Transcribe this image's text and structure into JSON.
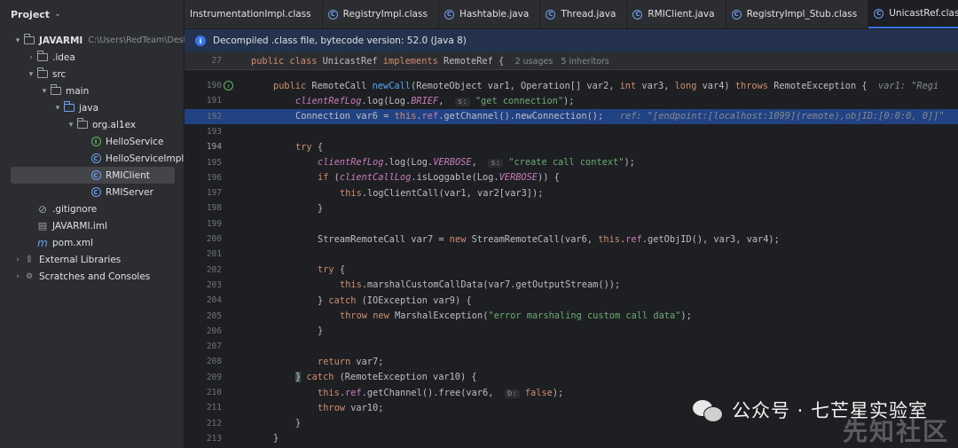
{
  "project": {
    "title": "Project",
    "tree": [
      {
        "label": "JAVARMI",
        "sub": "C:\\Users\\RedTeam\\Deskt",
        "indent": 0,
        "arrow": "▾",
        "icon": "folder",
        "bold": true
      },
      {
        "label": ".idea",
        "indent": 1,
        "arrow": "›",
        "icon": "folder"
      },
      {
        "label": "src",
        "indent": 1,
        "arrow": "▾",
        "icon": "folder"
      },
      {
        "label": "main",
        "indent": 2,
        "arrow": "▾",
        "icon": "folder"
      },
      {
        "label": "java",
        "indent": 3,
        "arrow": "▾",
        "icon": "folder-blue"
      },
      {
        "label": "org.al1ex",
        "indent": 4,
        "arrow": "▾",
        "icon": "folder"
      },
      {
        "label": "HelloService",
        "indent": 5,
        "arrow": "",
        "icon": "interface"
      },
      {
        "label": "HelloServiceImpl",
        "indent": 5,
        "arrow": "",
        "icon": "class"
      },
      {
        "label": "RMIClient",
        "indent": 5,
        "arrow": "",
        "icon": "class",
        "selected": true
      },
      {
        "label": "RMIServer",
        "indent": 5,
        "arrow": "",
        "icon": "class"
      },
      {
        "label": ".gitignore",
        "indent": 1,
        "arrow": "",
        "icon": "gitignore"
      },
      {
        "label": "JAVARMI.iml",
        "indent": 1,
        "arrow": "",
        "icon": "file"
      },
      {
        "label": "pom.xml",
        "indent": 1,
        "arrow": "",
        "icon": "maven"
      },
      {
        "label": "External Libraries",
        "indent": 0,
        "arrow": "›",
        "icon": "library"
      },
      {
        "label": "Scratches and Consoles",
        "indent": 0,
        "arrow": "›",
        "icon": "scratch"
      }
    ]
  },
  "tabs": [
    {
      "label": "InstrumentationImpl.class",
      "icon": "none"
    },
    {
      "label": "RegistryImpl.class",
      "icon": "class"
    },
    {
      "label": "Hashtable.java",
      "icon": "class"
    },
    {
      "label": "Thread.java",
      "icon": "class"
    },
    {
      "label": "RMIClient.java",
      "icon": "class"
    },
    {
      "label": "RegistryImpl_Stub.class",
      "icon": "class"
    },
    {
      "label": "UnicastRef.class",
      "icon": "class",
      "active": true
    }
  ],
  "banner": {
    "text": "Decompiled .class file, bytecode version: 52.0 (Java 8)"
  },
  "sticky": {
    "num": "27",
    "html": "<span class='k'>public class </span><span class='t'>UnicastRef </span><span class='k'>implements </span><span class='t'>RemoteRef {  </span><span class='dim' style='font-style:normal;font-family:DejaVu Sans,sans-serif;font-size:9.5px'>2 usages   5 inheritors</span>"
  },
  "lines": [
    {
      "num": "190",
      "mark": true,
      "indent": 1,
      "html": "<span class='k'>public </span><span class='t'>RemoteCall </span><span class='m'>newCall</span><span class='t'>(RemoteObject var1, Operation[] var2, </span><span class='k'>int </span><span class='t'>var3, </span><span class='k'>long </span><span class='t'>var4) </span><span class='k'>throws </span><span class='t'>RemoteException {  </span><span class='dim'>var1: \"Regi</span>"
    },
    {
      "num": "191",
      "indent": 2,
      "html": "<span class='fi'>clientRefLog</span><span class='t'>.log(Log.</span><span class='st'>BRIEF</span><span class='t'>,  </span><span class='hint'>s:</span><span class='s'> \"get connection\"</span><span class='t'>);</span>"
    },
    {
      "num": "192",
      "indent": 2,
      "hl": true,
      "html": "<span class='t'>Connection var6 = </span><span class='k'>this</span><span class='t'>.</span><span class='f'>ref</span><span class='t'>.getChannel().newConnection();   </span><span class='dim'>ref: \"[endpoint:[localhost:1099](remote),objID:[0:0:0, 0]]\"</span>"
    },
    {
      "num": "193",
      "indent": 0,
      "html": ""
    },
    {
      "num": "194",
      "indent": 2,
      "cur": true,
      "html": "<span class='k'>try </span><span class='t'>{</span>"
    },
    {
      "num": "195",
      "indent": 3,
      "html": "<span class='fi'>clientRefLog</span><span class='t'>.log(Log.</span><span class='st'>VERBOSE</span><span class='t'>,  </span><span class='hint'>s:</span><span class='s'> \"create call context\"</span><span class='t'>);</span>"
    },
    {
      "num": "196",
      "indent": 3,
      "html": "<span class='k'>if </span><span class='t'>(</span><span class='fi'>clientCallLog</span><span class='t'>.isLoggable(Log.</span><span class='st'>VERBOSE</span><span class='t'>)) {</span>"
    },
    {
      "num": "197",
      "indent": 4,
      "html": "<span class='k'>this</span><span class='t'>.logClientCall(var1, var2[var3]);</span>"
    },
    {
      "num": "198",
      "indent": 3,
      "html": "<span class='t'>}</span>"
    },
    {
      "num": "199",
      "indent": 0,
      "html": ""
    },
    {
      "num": "200",
      "indent": 3,
      "html": "<span class='t'>StreamRemoteCall var7 = </span><span class='k'>new </span><span class='t'>StreamRemoteCall(var6, </span><span class='k'>this</span><span class='t'>.</span><span class='f'>ref</span><span class='t'>.getObjID(), var3, var4);</span>"
    },
    {
      "num": "201",
      "indent": 0,
      "html": ""
    },
    {
      "num": "202",
      "indent": 3,
      "html": "<span class='k'>try </span><span class='t'>{</span>"
    },
    {
      "num": "203",
      "indent": 4,
      "html": "<span class='k'>this</span><span class='t'>.marshalCustomCallData(var7.getOutputStream());</span>"
    },
    {
      "num": "204",
      "indent": 3,
      "html": "<span class='t'>} </span><span class='k'>catch </span><span class='t'>(IOException var9) {</span>"
    },
    {
      "num": "205",
      "indent": 4,
      "html": "<span class='k'>throw new </span><span class='t'>MarshalException(</span><span class='s'>\"error marshaling custom call data\"</span><span class='t'>);</span>"
    },
    {
      "num": "206",
      "indent": 3,
      "html": "<span class='t'>}</span>"
    },
    {
      "num": "207",
      "indent": 0,
      "html": ""
    },
    {
      "num": "208",
      "indent": 3,
      "html": "<span class='k'>return </span><span class='t'>var7;</span>"
    },
    {
      "num": "209",
      "indent": 2,
      "html": "<span class='t' style='background:#3b514d'>}</span><span class='t'> </span><span class='k'>catch </span><span class='t'>(RemoteException var10) {</span>"
    },
    {
      "num": "210",
      "indent": 3,
      "html": "<span class='k'>this</span><span class='t'>.</span><span class='f'>ref</span><span class='t'>.getChannel().free(var6,  </span><span class='hint'>b:</span><span class='k'> false</span><span class='t'>);</span>"
    },
    {
      "num": "211",
      "indent": 3,
      "html": "<span class='k'>throw </span><span class='t'>var10;</span>"
    },
    {
      "num": "212",
      "indent": 2,
      "html": "<span class='t'>}</span>"
    },
    {
      "num": "213",
      "indent": 1,
      "html": "<span class='t'>}</span>"
    }
  ],
  "watermark": {
    "text": "公众号 · 七芒星实验室",
    "site": "先知社区"
  }
}
